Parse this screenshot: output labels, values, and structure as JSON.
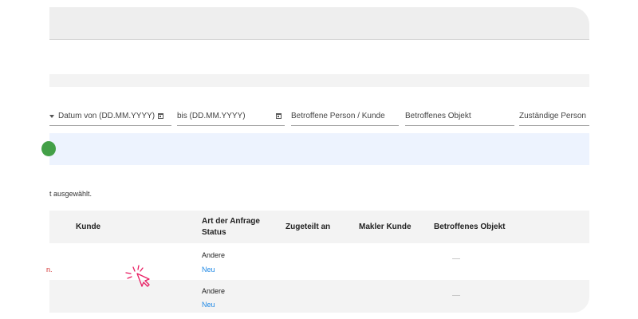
{
  "filters": {
    "date_from_placeholder": "Datum von (DD.MM.YYYY)",
    "date_to_placeholder": "bis (DD.MM.YYYY)",
    "person_customer_placeholder": "Betroffene Person / Kunde",
    "object_placeholder": "Betroffenes Objekt",
    "responsible_placeholder": "Zuständige Person"
  },
  "selection_info": "t ausgewählt.",
  "table": {
    "headers": {
      "kunde": "Kunde",
      "art_line1": "Art der Anfrage",
      "art_line2": "Status",
      "zugeteilt": "Zugeteilt an",
      "makler": "Makler Kunde",
      "objekt": "Betroffenes Objekt"
    },
    "rows": [
      {
        "left_fragment": "n.",
        "art": "Andere",
        "status": "Neu"
      },
      {
        "left_fragment": "",
        "art": "Andere",
        "status": "Neu"
      }
    ]
  },
  "colors": {
    "accent_green": "#43a047",
    "status_blue": "#1e88e5",
    "error_red": "#d32f2f",
    "cursor_pink": "#e91e63"
  }
}
